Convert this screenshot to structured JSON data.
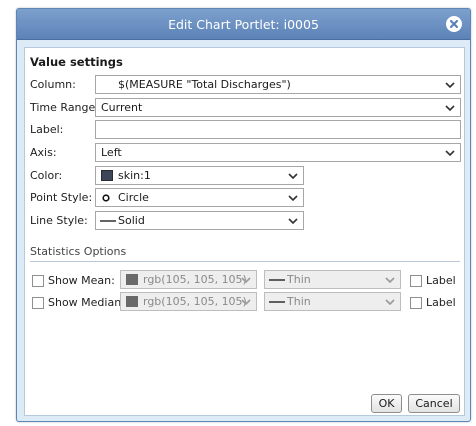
{
  "dialog": {
    "title": "Edit Chart Portlet: i0005",
    "close_icon": "close-circle-icon"
  },
  "value_settings": {
    "section_title": "Value settings",
    "column": {
      "label": "Column:",
      "value": "$(MEASURE \"Total Discharges\")"
    },
    "time_range": {
      "label": "Time Range:",
      "value": "Current"
    },
    "label_field": {
      "label": "Label:",
      "value": ""
    },
    "axis": {
      "label": "Axis:",
      "value": "Left"
    },
    "color": {
      "label": "Color:",
      "value": "skin:1",
      "swatch_color": "#3c4658"
    },
    "point_style": {
      "label": "Point Style:",
      "value": "Circle",
      "icon": "circle-point-icon"
    },
    "line_style": {
      "label": "Line Style:",
      "value": "Solid",
      "icon": "solid-line-icon"
    }
  },
  "statistics": {
    "section_title": "Statistics Options",
    "mean": {
      "checkbox_label": "Show Mean:",
      "checked": false,
      "color": "rgb(105, 105, 105)",
      "swatch_color": "#696969",
      "line": "Thin",
      "label_text": "Label",
      "label_checked": false
    },
    "median": {
      "checkbox_label": "Show Median:",
      "checked": false,
      "color": "rgb(105, 105, 105)",
      "swatch_color": "#696969",
      "line": "Thin",
      "label_text": "Label",
      "label_checked": false
    }
  },
  "footer": {
    "ok": "OK",
    "cancel": "Cancel"
  },
  "colors": {
    "titlebar": "#5c83b8",
    "dialog_bg": "#ddebf6"
  }
}
